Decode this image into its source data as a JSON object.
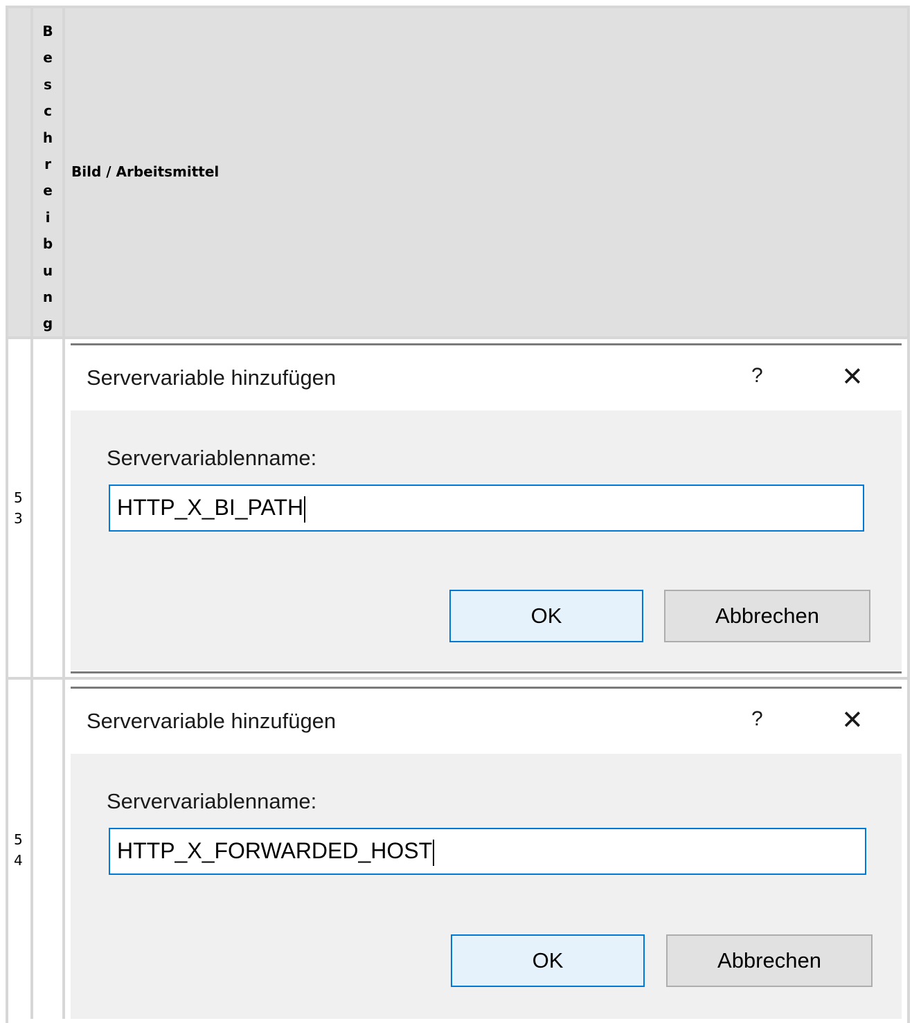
{
  "table": {
    "header": {
      "col2_label": "Beschreibung",
      "col3_label": "Bild / Arbeitsmittel"
    },
    "rows": [
      {
        "number": "53",
        "dialog": {
          "title": "Servervariable hinzufügen",
          "help_icon": "?",
          "close_icon": "close-icon",
          "field_label": "Servervariablenname:",
          "field_value": "HTTP_X_BI_PATH",
          "ok_label": "OK",
          "cancel_label": "Abbrechen"
        }
      },
      {
        "number": "54",
        "dialog": {
          "title": "Servervariable hinzufügen",
          "help_icon": "?",
          "close_icon": "close-icon",
          "field_label": "Servervariablenname:",
          "field_value": "HTTP_X_FORWARDED_HOST",
          "ok_label": "OK",
          "cancel_label": "Abbrechen"
        }
      }
    ]
  }
}
